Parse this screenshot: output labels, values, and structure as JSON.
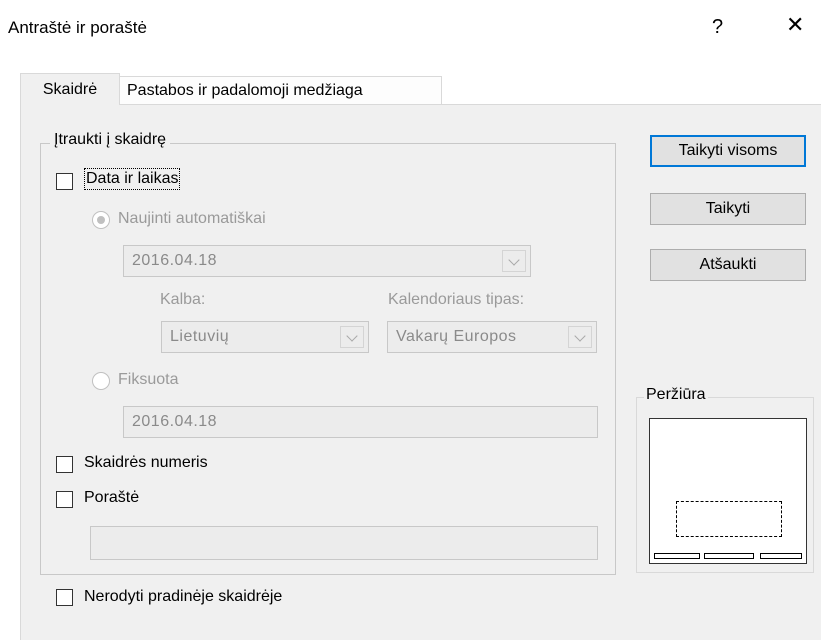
{
  "window": {
    "title": "Antraštė ir poraštė",
    "help_glyph": "?",
    "close_glyph": "✕"
  },
  "tabs": [
    {
      "label": "Skaidrė",
      "active": true
    },
    {
      "label": "Pastabos ir padalomoji medžiaga",
      "active": false
    }
  ],
  "group": {
    "label": "Įtraukti į skaidrę"
  },
  "date_time": {
    "label": "Data ir laikas",
    "checked": false
  },
  "auto_update": {
    "label": "Naujinti automatiškai",
    "selected": true,
    "date_value": "2016.04.18",
    "language_label": "Kalba:",
    "language_value": "Lietuvių",
    "calendar_label": "Kalendoriaus tipas:",
    "calendar_value": "Vakarų Europos"
  },
  "fixed": {
    "label": "Fiksuota",
    "selected": false,
    "value": "2016.04.18"
  },
  "slide_number": {
    "label": "Skaidrės numeris",
    "checked": false
  },
  "footer": {
    "label": "Poraštė",
    "checked": false,
    "value": ""
  },
  "dont_show_title": {
    "label": "Nerodyti pradinėje skaidrėje",
    "checked": false
  },
  "buttons": {
    "apply_all": "Taikyti visoms",
    "apply": "Taikyti",
    "cancel": "Atšaukti"
  },
  "preview": {
    "label": "Peržiūra"
  },
  "colors": {
    "dialog_bg": "#f0f0f0",
    "default_button_border": "#0078d7",
    "disabled_text": "#9a9a9a"
  }
}
